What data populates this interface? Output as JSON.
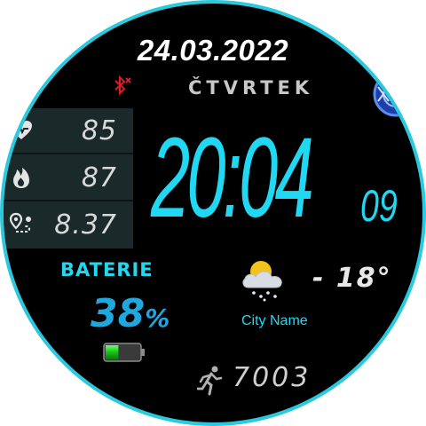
{
  "date": "24.03.2022",
  "weekday": "ČTVRTEK",
  "time": {
    "hours_minutes": "20:04",
    "seconds": "09"
  },
  "stats": {
    "heart_rate": "85",
    "calories": "87",
    "distance": "8.37"
  },
  "battery": {
    "label": "BATERIE",
    "value": "38",
    "unit": "%",
    "level_percent": 38
  },
  "weather": {
    "temperature": "- 18°",
    "city": "City Name"
  },
  "steps": "7003",
  "colors": {
    "accent": "#21d8f2",
    "ring": "#2ac9de",
    "panel": "#1a2a2a",
    "background": "#000000"
  },
  "icons": [
    "bluetooth-disconnected-icon",
    "heart-icon",
    "flame-icon",
    "location-route-icon",
    "battery-icon",
    "weather-cloud-snow-icon",
    "running-person-icon"
  ]
}
